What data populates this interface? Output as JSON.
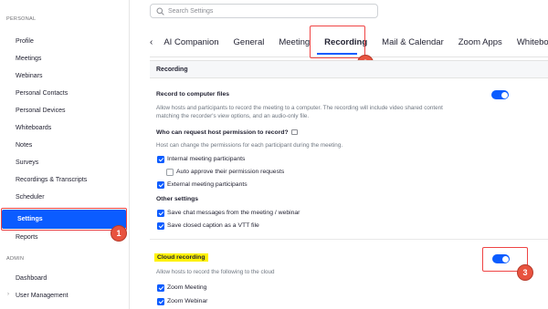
{
  "sidebar": {
    "personal_title": "PERSONAL",
    "items": [
      {
        "label": "Profile"
      },
      {
        "label": "Meetings"
      },
      {
        "label": "Webinars"
      },
      {
        "label": "Personal Contacts"
      },
      {
        "label": "Personal Devices"
      },
      {
        "label": "Whiteboards"
      },
      {
        "label": "Notes"
      },
      {
        "label": "Surveys"
      },
      {
        "label": "Recordings & Transcripts"
      },
      {
        "label": "Scheduler"
      },
      {
        "label": "Settings"
      },
      {
        "label": "Reports"
      }
    ],
    "admin_title": "ADMIN",
    "admin_items": [
      {
        "label": "Dashboard"
      },
      {
        "label": "User Management"
      }
    ],
    "chevron_icon": "›"
  },
  "search": {
    "placeholder": "Search Settings"
  },
  "tabs": {
    "back_icon": "‹",
    "items": [
      {
        "label": "AI Companion"
      },
      {
        "label": "General"
      },
      {
        "label": "Meeting"
      },
      {
        "label": "Recording"
      },
      {
        "label": "Mail & Calendar"
      },
      {
        "label": "Zoom Apps"
      },
      {
        "label": "Whiteboard"
      }
    ]
  },
  "recording_section": {
    "title": "Recording"
  },
  "local_recording": {
    "title": "Record to computer files",
    "description": "Allow hosts and participants to record the meeting to a computer. The recording will include video shared content matching the recorder's view options, and an audio-only file.",
    "enabled": true,
    "permission_title": "Who can request host permission to record?",
    "permission_desc": "Host can change the permissions for each participant during the meeting.",
    "options": [
      {
        "label": "Internal meeting participants",
        "checked": true
      },
      {
        "label": "Auto approve their permission requests",
        "checked": false
      },
      {
        "label": "External meeting participants",
        "checked": true
      }
    ],
    "other_title": "Other settings",
    "other_options": [
      {
        "label": "Save chat messages from the meeting / webinar",
        "checked": true
      },
      {
        "label": "Save closed caption as a VTT file",
        "checked": true
      }
    ]
  },
  "cloud_recording": {
    "title": "Cloud recording",
    "description": "Allow hosts to record the following to the cloud",
    "enabled": true,
    "options": [
      {
        "label": "Zoom Meeting",
        "checked": true
      },
      {
        "label": "Zoom Webinar",
        "checked": true
      }
    ]
  },
  "callouts": {
    "one": "1",
    "two": "2",
    "three": "3"
  },
  "colors": {
    "accent": "#0b5cff",
    "callout": "#e8533f",
    "highlight": "#fff200"
  }
}
